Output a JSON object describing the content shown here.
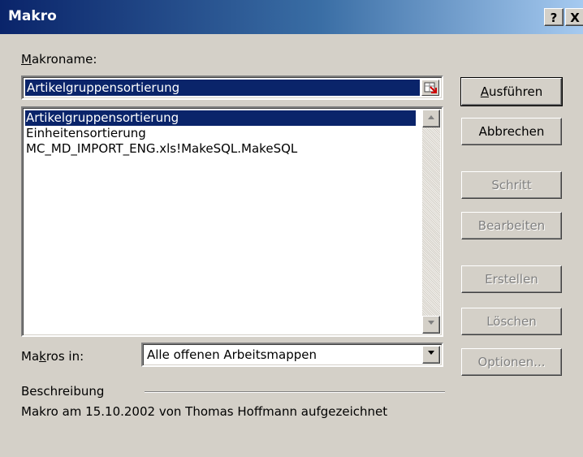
{
  "title": "Makro",
  "titlebar_buttons": {
    "help": "?",
    "close": "X"
  },
  "macro_name": {
    "label_accel": "M",
    "label_rest": "akroname:",
    "value": "Artikelgruppensortierung"
  },
  "macro_list": [
    {
      "label": "Artikelgruppensortierung",
      "selected": true
    },
    {
      "label": "Einheitensortierung",
      "selected": false
    },
    {
      "label": "MC_MD_IMPORT_ENG.xls!MakeSQL.MakeSQL",
      "selected": false
    }
  ],
  "buttons": {
    "run_accel": "A",
    "run_rest": "usführen",
    "cancel": "Abbrechen",
    "step": "Schritt",
    "edit": "Bearbeiten",
    "create": "Erstellen",
    "delete": "Löschen",
    "options": "Optionen..."
  },
  "macros_in": {
    "label_pre": "Ma",
    "label_accel": "k",
    "label_post": "ros in:",
    "value": "Alle offenen Arbeitsmappen"
  },
  "description": {
    "label": "Beschreibung",
    "text": "Makro am 15.10.2002 von Thomas Hoffmann aufgezeichnet"
  },
  "icons": {
    "scroll_up": "triangle-up-icon",
    "scroll_down": "triangle-down-icon",
    "combo_arrow": "triangle-down-icon",
    "ref": "range-select-icon"
  },
  "colors": {
    "titlebar_start": "#0a246a",
    "titlebar_end": "#a6caf0",
    "selection": "#0a246a",
    "face": "#d4d0c8"
  }
}
